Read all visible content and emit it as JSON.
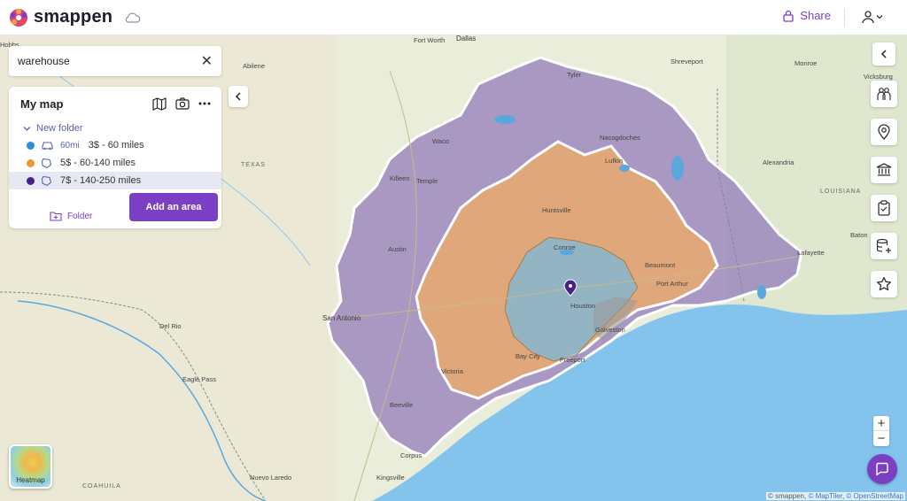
{
  "app": {
    "name": "smappen"
  },
  "header": {
    "share_label": "Share"
  },
  "search": {
    "value": "warehouse",
    "placeholder": ""
  },
  "panel": {
    "title": "My map",
    "folder_name": "New folder",
    "areas": [
      {
        "color": "#2a8fd6",
        "mode": "car",
        "distance": "60mi",
        "label": "3$ - 60 miles"
      },
      {
        "color": "#f0962e",
        "mode": "polygon",
        "distance": "",
        "label": "5$ - 60-140 miles"
      },
      {
        "color": "#4a1f86",
        "mode": "polygon",
        "distance": "",
        "label": "7$ - 140-250 miles"
      }
    ],
    "folder_button_label": "Folder",
    "add_area_label": "Add an area"
  },
  "map": {
    "cities": [
      "Fort Worth",
      "Dallas",
      "Hobbs",
      "Abilene",
      "Tyler",
      "Shreveport",
      "Monroe",
      "Vicksburg",
      "Waco",
      "Nacogdoches",
      "Lufkin",
      "Alexandria",
      "Killeen",
      "Temple",
      "Huntsville",
      "Austin",
      "Conroe",
      "Beaumont",
      "Lafayette",
      "Baton",
      "Port Arthur",
      "Houston",
      "San Antonio",
      "Galveston",
      "Del Rio",
      "Bay City",
      "Freeport",
      "Victoria",
      "Eagle Pass",
      "Beeville",
      "Corpus",
      "Nuevo Laredo",
      "Kingsville"
    ],
    "regions": [
      "TEXAS",
      "LOUISIANA",
      "COAHUILA"
    ]
  },
  "heatmap": {
    "label": "Heatmap"
  },
  "attribution": {
    "prefix": "© smappen, ",
    "maptiler": "© MapTiler",
    "sep": ", ",
    "osm": "© OpenStreetMap"
  }
}
